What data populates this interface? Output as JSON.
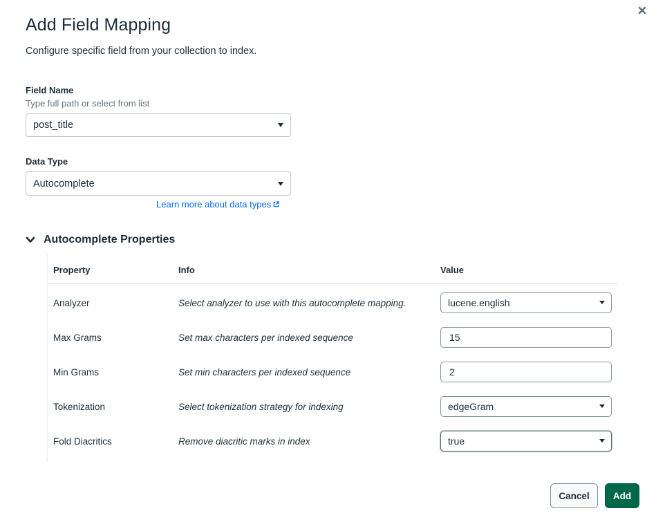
{
  "modal": {
    "title": "Add Field Mapping",
    "subtitle": "Configure specific field from your collection to index."
  },
  "field_name": {
    "label": "Field Name",
    "hint": "Type full path or select from list",
    "value": "post_title"
  },
  "data_type": {
    "label": "Data Type",
    "value": "Autocomplete",
    "learn_more_link": "Learn more about data types"
  },
  "section": {
    "title": "Autocomplete Properties",
    "expanded": true
  },
  "table": {
    "headers": {
      "property": "Property",
      "info": "Info",
      "value": "Value"
    },
    "rows": [
      {
        "property": "Analyzer",
        "info": "Select analyzer to use with this autocomplete mapping.",
        "value": "lucene.english",
        "control": "select"
      },
      {
        "property": "Max Grams",
        "info": "Set max characters per indexed sequence",
        "value": "15",
        "control": "input"
      },
      {
        "property": "Min Grams",
        "info": "Set min characters per indexed sequence",
        "value": "2",
        "control": "input"
      },
      {
        "property": "Tokenization",
        "info": "Select tokenization strategy for indexing",
        "value": "edgeGram",
        "control": "select"
      },
      {
        "property": "Fold Diacritics",
        "info": "Remove diacritic marks in index",
        "value": "true",
        "control": "select"
      }
    ]
  },
  "footer": {
    "cancel_label": "Cancel",
    "add_label": "Add"
  },
  "colors": {
    "primary_button": "#00684a",
    "link": "#016bf8",
    "text": "#1c2d38"
  },
  "icons": {
    "close": "close-icon",
    "caret": "caret-down-icon",
    "external_link": "external-link-icon",
    "chevron": "chevron-down-icon"
  }
}
